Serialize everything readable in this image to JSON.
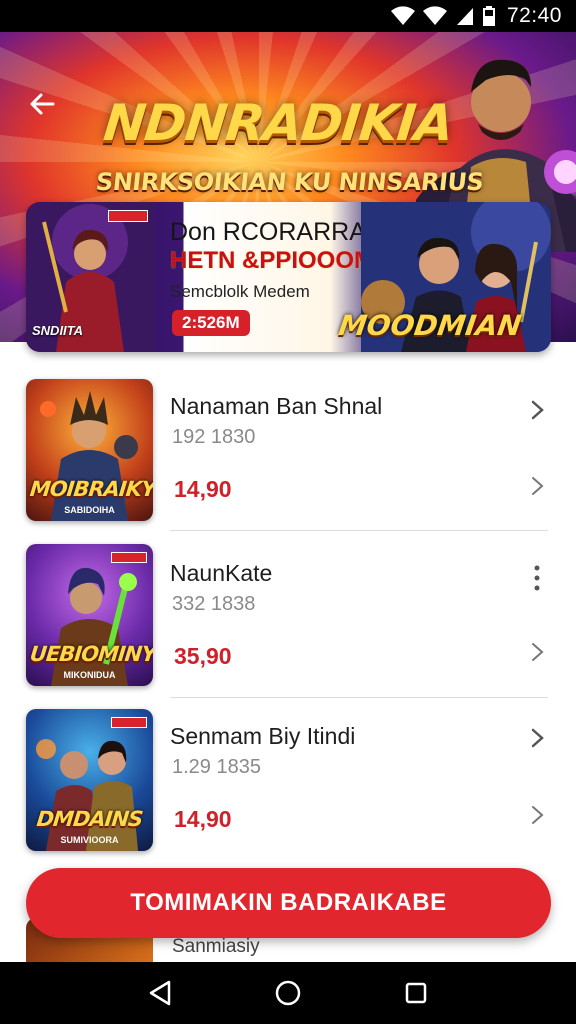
{
  "status_bar": {
    "time": "72:40"
  },
  "hero": {
    "title": "NDNRADIKIA",
    "subtitle": "SNIRKSOIKIAN KU NINSARIUS"
  },
  "promo": {
    "thumb_label": "SNDIITA",
    "title": "Don RCORARRA",
    "headline": "HETN &PPIOOOM",
    "caption": "Semcblolk Medem",
    "badge": "2:526M",
    "logo": "MOODMIAN"
  },
  "games": [
    {
      "name": "Nanaman Ban Shnal",
      "meta": "192 1830",
      "price": "14,90",
      "thumb_logo": "MOIBRAIKY",
      "thumb_sub": "SABIDOIHA",
      "action": "chevron"
    },
    {
      "name": "NaunKate",
      "meta": "332 1838",
      "price": "35,90",
      "thumb_logo": "UEBIOMINY",
      "thumb_sub": "MIKONIDUA",
      "action": "more"
    },
    {
      "name": "Senmam Biy Itindi",
      "meta": "1.29 1835",
      "price": "14,90",
      "thumb_logo": "DMDAINS",
      "thumb_sub": "SUMIVIOORA",
      "action": "chevron"
    }
  ],
  "peek": {
    "text": "Sanmiasiy"
  },
  "cta": {
    "label": "TOMIMAKIN BADRAIKABE"
  },
  "colors": {
    "accent": "#e1262e",
    "price": "#d0202a"
  }
}
